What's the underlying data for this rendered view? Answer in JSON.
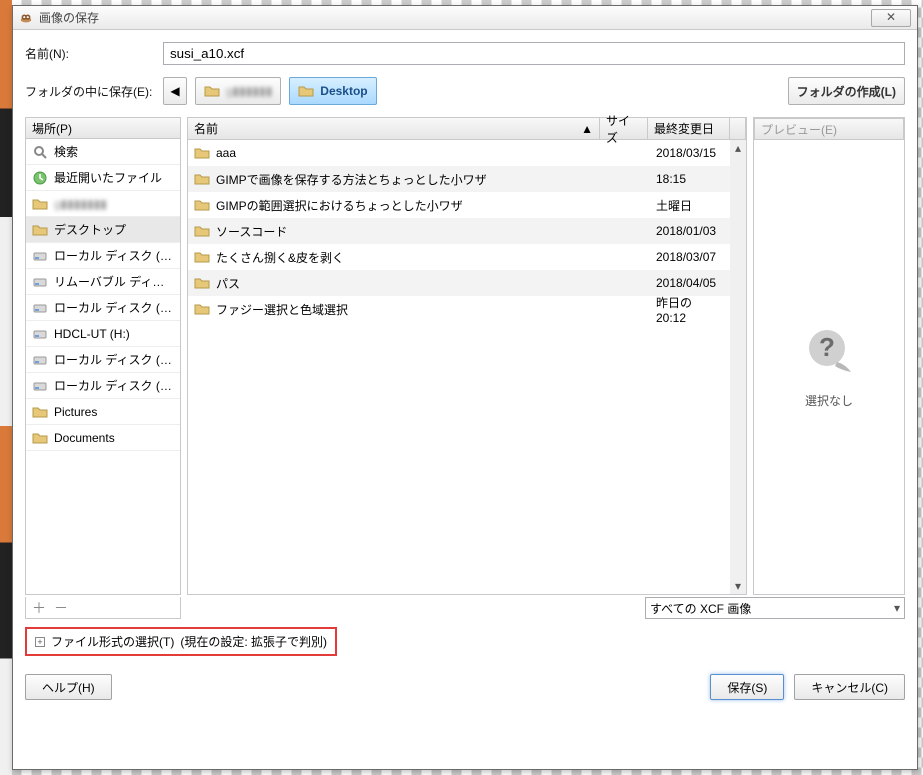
{
  "window": {
    "title": "画像の保存"
  },
  "name": {
    "label": "名前(N):",
    "value": "susi_a10.xcf"
  },
  "folder": {
    "label": "フォルダの中に保存(E):",
    "back": "◀",
    "current_pix": "g▮▮▮▮▮▮",
    "desktop": "Desktop",
    "create": "フォルダの作成(L)"
  },
  "places": {
    "header": "場所(P)",
    "items": [
      {
        "icon": "search",
        "label": "検索"
      },
      {
        "icon": "recent",
        "label": "最近開いたファイル"
      },
      {
        "icon": "folder",
        "label": "g▮▮▮▮▮▮▮",
        "blur": true
      },
      {
        "icon": "folder",
        "label": "デスクトップ",
        "selected": true
      },
      {
        "icon": "disk",
        "label": "ローカル ディスク (…"
      },
      {
        "icon": "disk",
        "label": "リムーバブル ディ…"
      },
      {
        "icon": "disk",
        "label": "ローカル ディスク (…"
      },
      {
        "icon": "disk",
        "label": "HDCL-UT (H:)"
      },
      {
        "icon": "disk",
        "label": "ローカル ディスク (…"
      },
      {
        "icon": "disk",
        "label": "ローカル ディスク (…"
      },
      {
        "icon": "folder",
        "label": "Pictures"
      },
      {
        "icon": "folder",
        "label": "Documents"
      }
    ]
  },
  "files": {
    "head": {
      "name": "名前",
      "size": "サイズ",
      "modified": "最終変更日"
    },
    "rows": [
      {
        "name": "aaa",
        "date": "2018/03/15"
      },
      {
        "name": "GIMPで画像を保存する方法とちょっとした小ワザ",
        "date": "18:15"
      },
      {
        "name": "GIMPの範囲選択におけるちょっとした小ワザ",
        "date": "土曜日"
      },
      {
        "name": "ソースコード",
        "date": "2018/01/03"
      },
      {
        "name": "たくさん捌く&皮を剥く",
        "date": "2018/03/07"
      },
      {
        "name": "パス",
        "date": "2018/04/05"
      },
      {
        "name": "ファジー選択と色域選択",
        "date": "昨日の 20:12"
      }
    ]
  },
  "preview": {
    "header": "プレビュー(E)",
    "none": "選択なし"
  },
  "filter": {
    "label": "すべての XCF 画像"
  },
  "filetype": {
    "label": "ファイル形式の選択(T)",
    "hint": "(現在の設定: 拡張子で判別)"
  },
  "actions": {
    "help": "ヘルプ(H)",
    "save": "保存(S)",
    "cancel": "キャンセル(C)"
  }
}
